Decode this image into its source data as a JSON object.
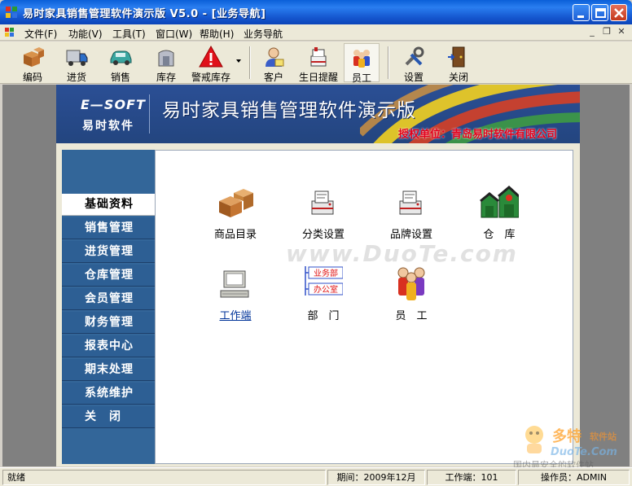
{
  "window": {
    "title": "易时家具销售管理软件演示版 V5.0 - [业务导航]"
  },
  "menubar": {
    "items": [
      "文件(F)",
      "功能(V)",
      "工具(T)",
      "窗口(W)",
      "帮助(H)",
      "业务导航"
    ],
    "mdi_buttons": [
      "minimize",
      "restore",
      "close"
    ]
  },
  "toolbar": {
    "buttons": [
      {
        "label": "编码",
        "icon": "boxes-icon"
      },
      {
        "label": "进货",
        "icon": "truck-icon"
      },
      {
        "label": "销售",
        "icon": "car-icon"
      },
      {
        "label": "库存",
        "icon": "storage-icon"
      },
      {
        "label": "警戒库存",
        "icon": "warning-icon"
      },
      {
        "label": "客户",
        "icon": "customer-icon"
      },
      {
        "label": "生日提醒",
        "icon": "birthday-icon"
      },
      {
        "label": "员工",
        "icon": "employees-icon"
      },
      {
        "label": "设置",
        "icon": "tools-icon"
      },
      {
        "label": "关闭",
        "icon": "exit-door-icon"
      }
    ]
  },
  "banner": {
    "logo_en": "E—SOFT",
    "logo_cn": "易时软件",
    "title": "易时家具销售管理软件演示版",
    "licensed_to": "授权单位：青岛易时软件有限公司"
  },
  "nav": {
    "items": [
      "基础资料",
      "销售管理",
      "进货管理",
      "仓库管理",
      "会员管理",
      "财务管理",
      "报表中心",
      "期末处理",
      "系统维护",
      "关　闭"
    ],
    "active": "基础资料"
  },
  "content": {
    "items": [
      {
        "label": "商品目录",
        "icon": "product-boxes-icon"
      },
      {
        "label": "分类设置",
        "icon": "category-printer-icon"
      },
      {
        "label": "品牌设置",
        "icon": "brand-printer-icon"
      },
      {
        "label": "仓　库",
        "icon": "warehouse-icon"
      },
      {
        "label": "工作端",
        "icon": "workstation-computer-icon"
      },
      {
        "label": "部　门",
        "icon": "department-tree-icon"
      },
      {
        "label": "员　工",
        "icon": "staff-people-icon"
      }
    ],
    "department_tree": [
      "业务部",
      "办公室"
    ]
  },
  "watermark": {
    "center": "www.DuoTe.com",
    "brand": "多特",
    "brand_suffix": "软件站",
    "domain": "DuoTe.Com",
    "slogan": "国内最安全的软件站"
  },
  "statusbar": {
    "status": "就绪",
    "period": "期间：2009年12月",
    "workstation": "工作端：101",
    "operator": "操作员：ADMIN"
  },
  "colors": {
    "titlebar": "#1658d0",
    "nav_bg": "#336699",
    "banner_bg": "#2b4f95",
    "licensed_text": "#e3001b"
  }
}
